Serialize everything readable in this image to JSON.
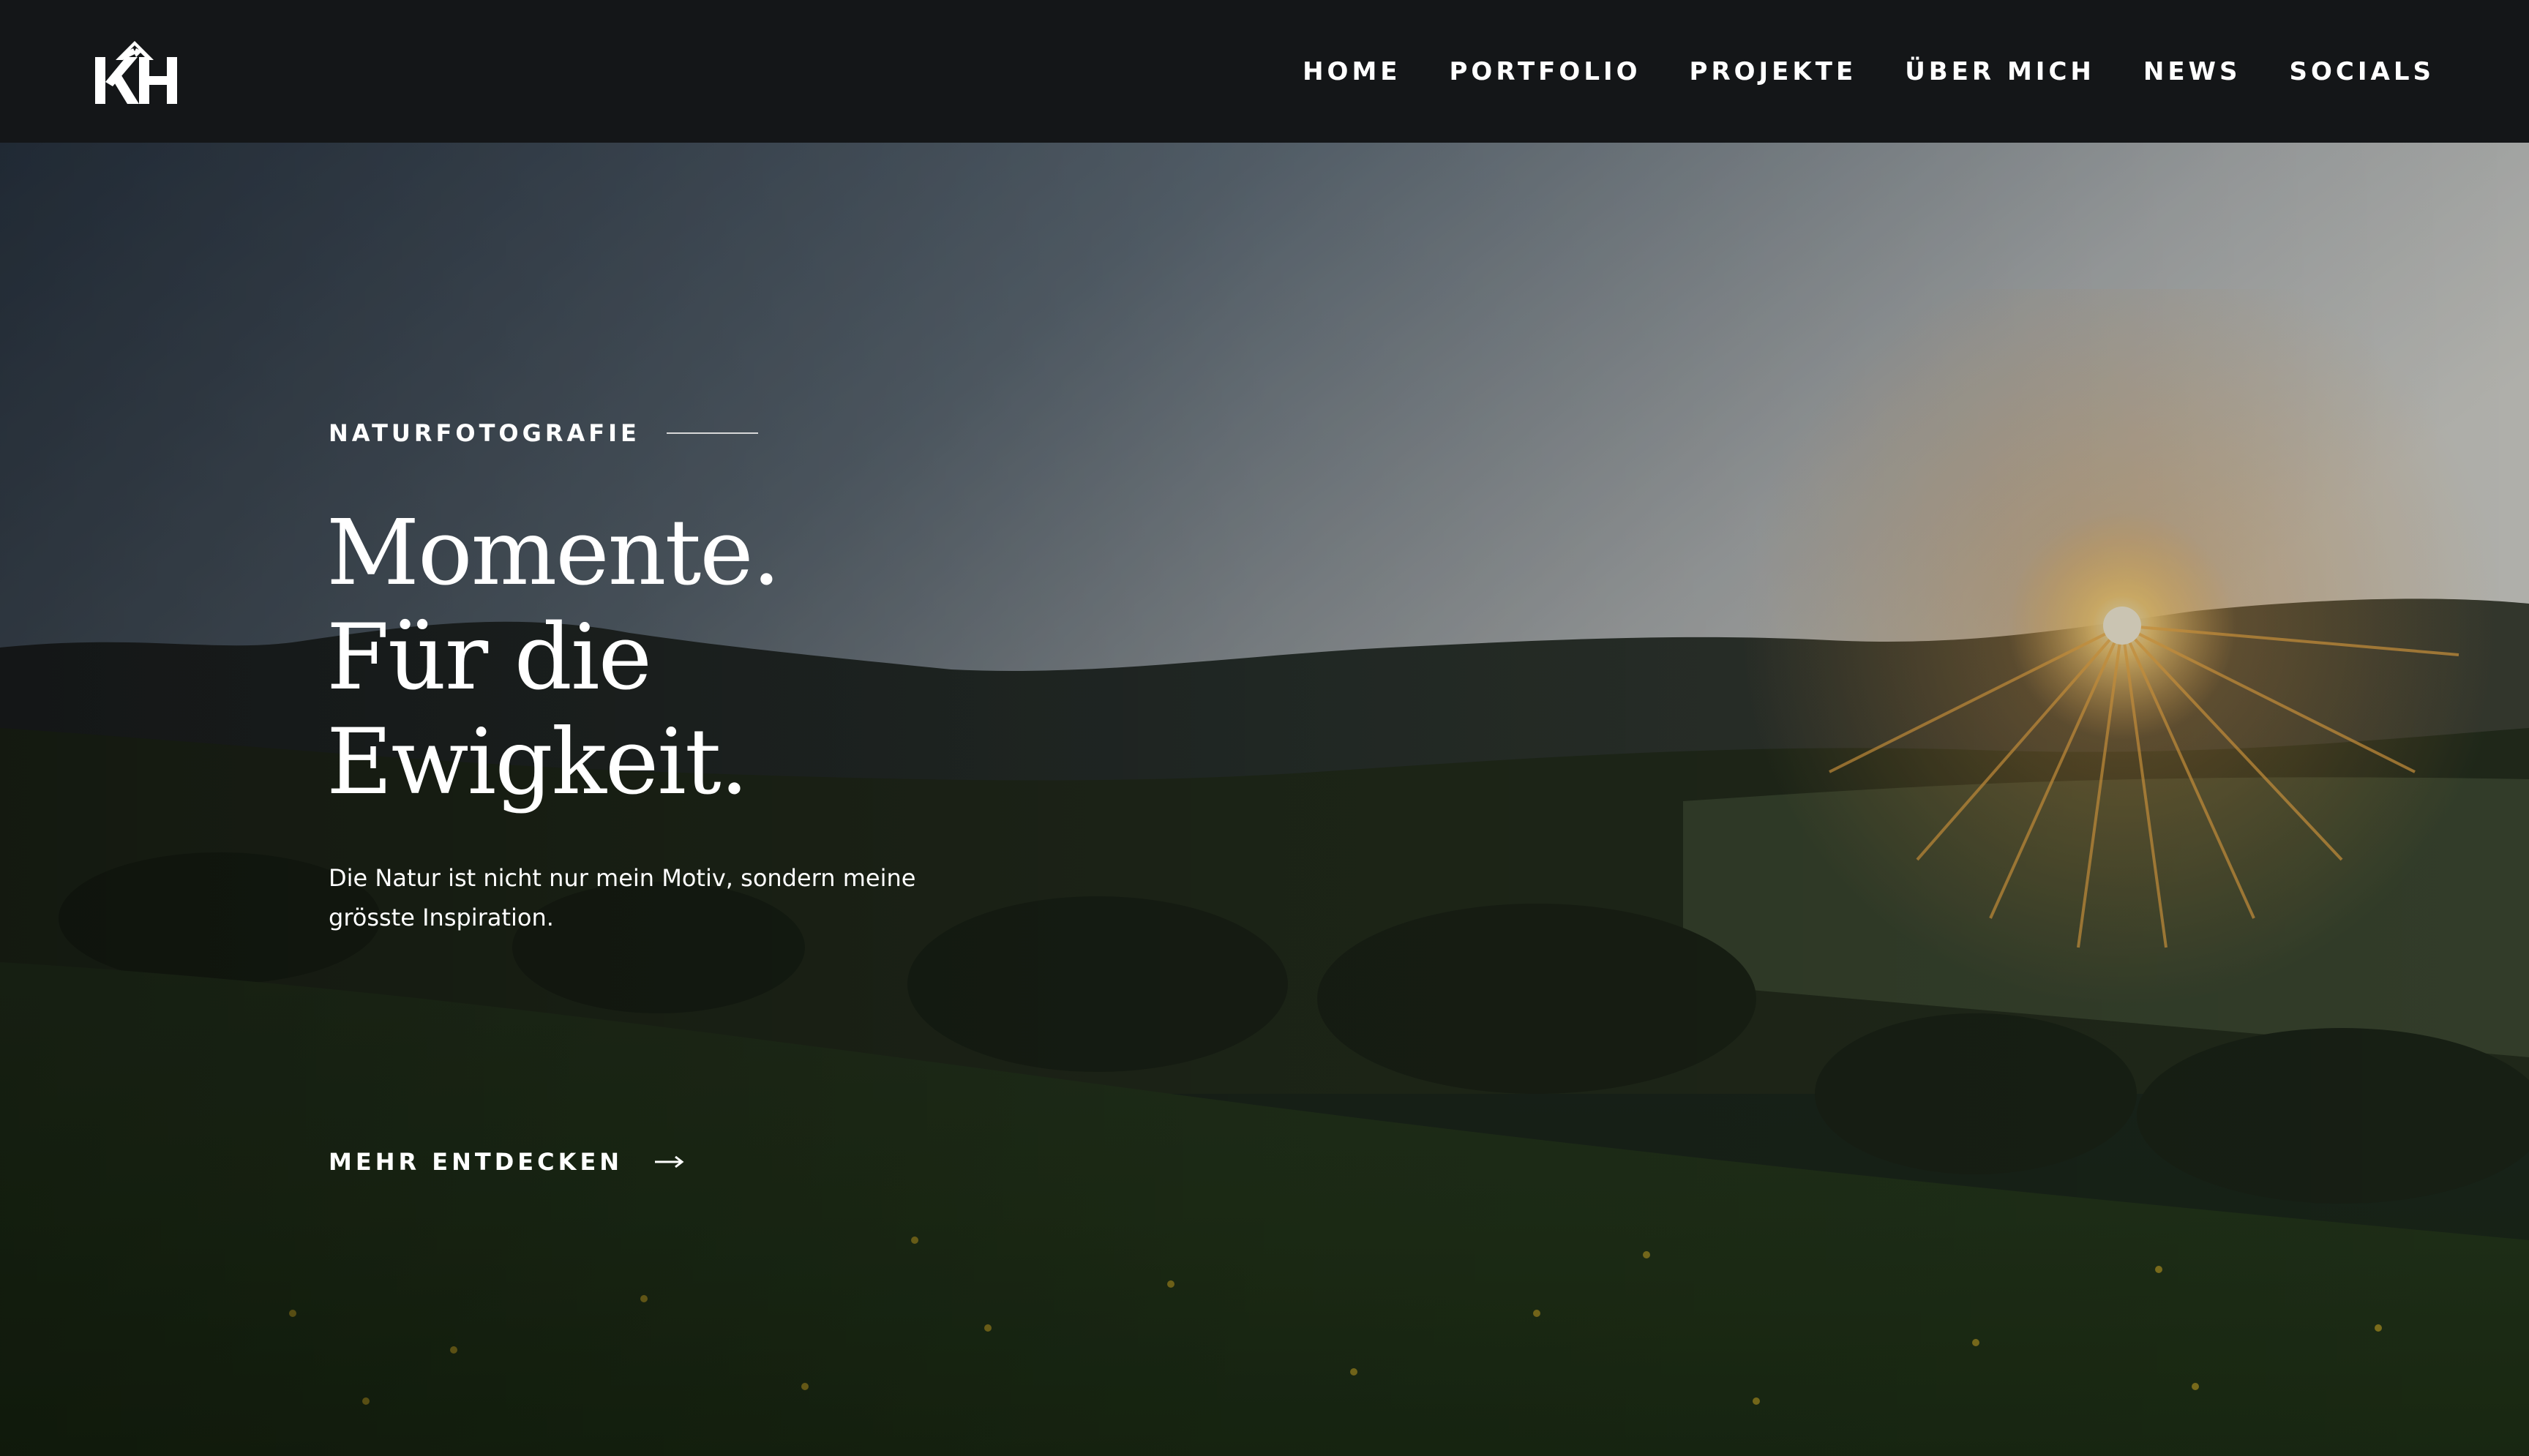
{
  "header": {
    "logo_icon": "kh-mountain-logo",
    "nav": [
      {
        "label": "HOME"
      },
      {
        "label": "PORTFOLIO"
      },
      {
        "label": "PROJEKTE"
      },
      {
        "label": "ÜBER MICH"
      },
      {
        "label": "NEWS"
      },
      {
        "label": "SOCIALS"
      }
    ]
  },
  "hero": {
    "eyebrow": "NATURFOTOGRAFIE",
    "headline": [
      "Momente.",
      "Für die",
      "Ewigkeit."
    ],
    "subtext_lines": [
      "Die Natur ist nicht nur mein Motiv, sondern meine",
      "grösste Inspiration."
    ],
    "cta_label": "MEHR ENTDECKEN",
    "cta_icon": "arrow-right-icon",
    "background_image": "sunset-meadow-landscape"
  },
  "colors": {
    "header_bg": "#141618",
    "text": "#ffffff",
    "sun": "#f2b44a"
  }
}
